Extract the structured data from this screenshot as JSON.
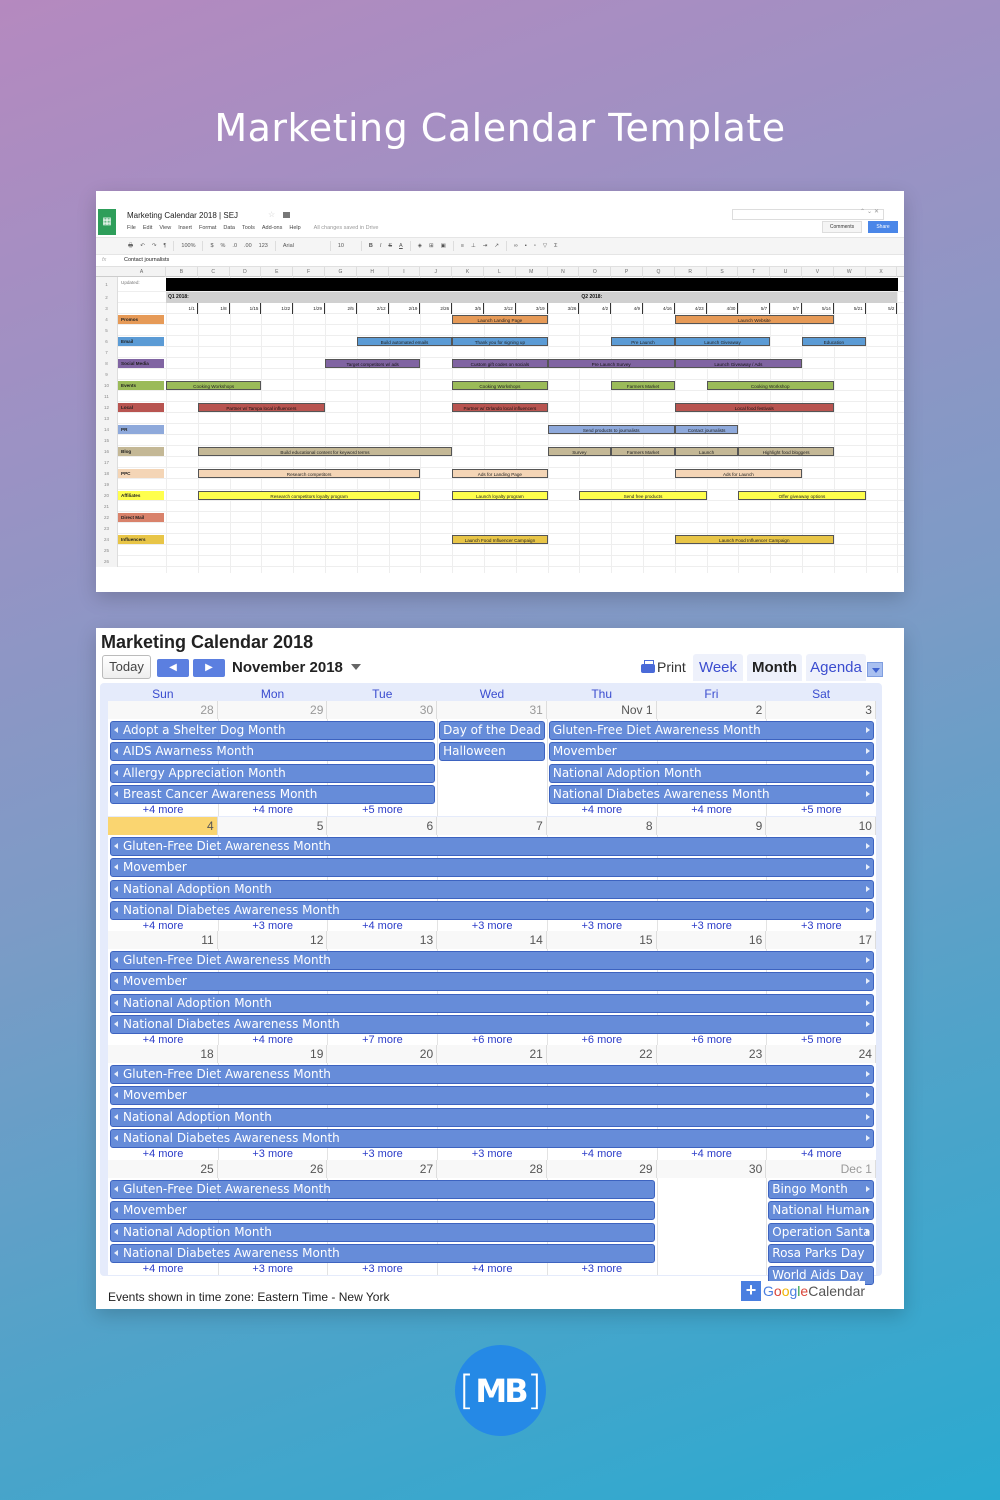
{
  "page": {
    "title": "Marketing Calendar Template",
    "logo_text": "MB",
    "background": {
      "top_left": "#b589bf",
      "bottom_right": "#2aaad0"
    },
    "logo_color": "#2589e6"
  },
  "spreadsheet": {
    "doc_title": "Marketing Calendar 2018 | SEJ",
    "menu": [
      "File",
      "Edit",
      "View",
      "Insert",
      "Format",
      "Data",
      "Tools",
      "Add-ons",
      "Help"
    ],
    "save_status": "All changes saved in Drive",
    "comments_label": "Comments",
    "share_label": "Share",
    "toolbar": {
      "zoom": "100%",
      "currency": "$",
      "percent": "%",
      "decimal_less": ".0",
      "decimal_more": ".00",
      "format": "123",
      "font": "Arial",
      "font_size": "10",
      "bold": "B",
      "italic": "I",
      "strike": "S",
      "text_color": "A"
    },
    "formula_bar_value": "Contact journalists",
    "columns": [
      "A",
      "B",
      "C",
      "D",
      "E",
      "F",
      "G",
      "H",
      "I",
      "J",
      "K",
      "L",
      "M",
      "N",
      "O",
      "P",
      "Q",
      "R",
      "S",
      "T",
      "U",
      "V",
      "W",
      "X"
    ],
    "updated_label": "Updated:",
    "q1_label": "Q1 2018:",
    "q2_label": "Q2 2018:",
    "week_dates": [
      "1/1",
      "1/8",
      "1/15",
      "1/22",
      "1/29",
      "2/5",
      "2/12",
      "2/19",
      "2/26",
      "3/5",
      "3/12",
      "3/19",
      "3/26",
      "4/2",
      "4/9",
      "4/16",
      "4/23",
      "4/30",
      "5/7",
      "5/7",
      "5/14",
      "5/21",
      "5/2"
    ],
    "channels": [
      {
        "row": 4,
        "label": "Promos",
        "color": "#e69a57"
      },
      {
        "row": 6,
        "label": "Email",
        "color": "#5b9bd5"
      },
      {
        "row": 8,
        "label": "Social Media",
        "color": "#8064a2"
      },
      {
        "row": 10,
        "label": "Events",
        "color": "#9bbb59"
      },
      {
        "row": 12,
        "label": "Local",
        "color": "#b85450"
      },
      {
        "row": 14,
        "label": "PR",
        "color": "#8ea9db"
      },
      {
        "row": 16,
        "label": "Blog",
        "color": "#c4b896"
      },
      {
        "row": 18,
        "label": "PPC",
        "color": "#f4d5b6"
      },
      {
        "row": 20,
        "label": "Affiliates",
        "color": "#ffff4d"
      },
      {
        "row": 22,
        "label": "Direct Mail",
        "color": "#d9826b"
      },
      {
        "row": 24,
        "label": "Influencers",
        "color": "#e8c547"
      }
    ],
    "tasks": [
      {
        "row": 4,
        "start": 10,
        "span": 3,
        "label": "Launch Landing Page",
        "color": "#e69a57"
      },
      {
        "row": 4,
        "start": 17,
        "span": 5,
        "label": "Launch Website",
        "color": "#e69a57"
      },
      {
        "row": 6,
        "start": 7,
        "span": 3,
        "label": "Build automated emails",
        "color": "#5b9bd5"
      },
      {
        "row": 6,
        "start": 10,
        "span": 3,
        "label": "Thank you for signing up",
        "color": "#5b9bd5"
      },
      {
        "row": 6,
        "start": 15,
        "span": 2,
        "label": "Pre Launch",
        "color": "#5b9bd5"
      },
      {
        "row": 6,
        "start": 17,
        "span": 3,
        "label": "Launch Giveaway",
        "color": "#5b9bd5"
      },
      {
        "row": 6,
        "start": 21,
        "span": 2,
        "label": "Education",
        "color": "#5b9bd5"
      },
      {
        "row": 8,
        "start": 6,
        "span": 3,
        "label": "Target competitors w/ ads",
        "color": "#8064a2"
      },
      {
        "row": 8,
        "start": 10,
        "span": 3,
        "label": "Custom gift codes on socials",
        "color": "#8064a2"
      },
      {
        "row": 8,
        "start": 13,
        "span": 4,
        "label": "Pre Launch Survey",
        "color": "#8064a2"
      },
      {
        "row": 8,
        "start": 17,
        "span": 4,
        "label": "Launch Giveaway / Ads",
        "color": "#8064a2"
      },
      {
        "row": 10,
        "start": 1,
        "span": 3,
        "label": "Cooking Workshops",
        "color": "#9bbb59"
      },
      {
        "row": 10,
        "start": 10,
        "span": 3,
        "label": "Cooking Workshops",
        "color": "#9bbb59"
      },
      {
        "row": 10,
        "start": 15,
        "span": 2,
        "label": "Farmers Market",
        "color": "#9bbb59"
      },
      {
        "row": 10,
        "start": 18,
        "span": 4,
        "label": "Cooking Workshop",
        "color": "#9bbb59"
      },
      {
        "row": 12,
        "start": 2,
        "span": 4,
        "label": "Partner w/ Tampa local influencers",
        "color": "#b85450"
      },
      {
        "row": 12,
        "start": 10,
        "span": 3,
        "label": "Partner w/ Orlando local influencers",
        "color": "#b85450"
      },
      {
        "row": 12,
        "start": 17,
        "span": 5,
        "label": "Local food festivals",
        "color": "#b85450"
      },
      {
        "row": 14,
        "start": 13,
        "span": 4,
        "label": "Send products to journalists",
        "color": "#8ea9db"
      },
      {
        "row": 14,
        "start": 17,
        "span": 2,
        "label": "Contact journalists",
        "color": "#8ea9db"
      },
      {
        "row": 16,
        "start": 2,
        "span": 8,
        "label": "Build educational content for keyword terms",
        "color": "#c4b896"
      },
      {
        "row": 16,
        "start": 13,
        "span": 2,
        "label": "Survey",
        "color": "#c4b896"
      },
      {
        "row": 16,
        "start": 15,
        "span": 2,
        "label": "Farmers Market",
        "color": "#c4b896"
      },
      {
        "row": 16,
        "start": 17,
        "span": 2,
        "label": "Launch",
        "color": "#c4b896"
      },
      {
        "row": 16,
        "start": 19,
        "span": 3,
        "label": "Highlight food bloggers",
        "color": "#c4b896"
      },
      {
        "row": 18,
        "start": 2,
        "span": 7,
        "label": "Research competitors",
        "color": "#f4d5b6"
      },
      {
        "row": 18,
        "start": 10,
        "span": 3,
        "label": "Ads for Landing Page",
        "color": "#f4d5b6"
      },
      {
        "row": 18,
        "start": 17,
        "span": 4,
        "label": "Ads for Launch",
        "color": "#f4d5b6"
      },
      {
        "row": 20,
        "start": 2,
        "span": 7,
        "label": "Research competitors loyalty program",
        "color": "#ffff4d"
      },
      {
        "row": 20,
        "start": 10,
        "span": 3,
        "label": "Launch loyalty program",
        "color": "#ffff4d"
      },
      {
        "row": 20,
        "start": 14,
        "span": 4,
        "label": "Send free products",
        "color": "#ffff4d"
      },
      {
        "row": 20,
        "start": 19,
        "span": 4,
        "label": "Offer giveaway options",
        "color": "#ffff4d"
      },
      {
        "row": 24,
        "start": 10,
        "span": 3,
        "label": "Launch Food Influencer Campaign",
        "color": "#e8c547"
      },
      {
        "row": 24,
        "start": 17,
        "span": 5,
        "label": "Launch Food Influencer Campaign",
        "color": "#e8c547"
      }
    ]
  },
  "calendar": {
    "title": "Marketing Calendar 2018",
    "today_label": "Today",
    "prev_label": "◀",
    "next_label": "▶",
    "month_label": "November 2018",
    "print_label": "Print",
    "views": [
      {
        "label": "Week",
        "active": false
      },
      {
        "label": "Month",
        "active": true
      },
      {
        "label": "Agenda",
        "active": false
      }
    ],
    "days_of_week": [
      "Sun",
      "Mon",
      "Tue",
      "Wed",
      "Thu",
      "Fri",
      "Sat"
    ],
    "event_color": "#668cd9",
    "today_color": "#fad570",
    "weeks": [
      {
        "days": [
          {
            "label": "28",
            "other": true
          },
          {
            "label": "29",
            "other": true
          },
          {
            "label": "30",
            "other": true
          },
          {
            "label": "31",
            "other": true
          },
          {
            "label": "Nov 1"
          },
          {
            "label": "2"
          },
          {
            "label": "3"
          }
        ],
        "events": [
          {
            "title": "Adopt a Shelter Dog Month",
            "start": 0,
            "span": 3,
            "slot": 0,
            "cont_left": true,
            "cont_right": false
          },
          {
            "title": "AIDS Awarness Month",
            "start": 0,
            "span": 3,
            "slot": 1,
            "cont_left": true,
            "cont_right": false
          },
          {
            "title": "Allergy Appreciation Month",
            "start": 0,
            "span": 3,
            "slot": 2,
            "cont_left": true,
            "cont_right": false
          },
          {
            "title": "Breast Cancer Awareness Month",
            "start": 0,
            "span": 3,
            "slot": 3,
            "cont_left": true,
            "cont_right": false
          },
          {
            "title": "Day of the Dead",
            "start": 3,
            "span": 1,
            "slot": 0,
            "cont_left": false,
            "cont_right": false
          },
          {
            "title": "Halloween",
            "start": 3,
            "span": 1,
            "slot": 1,
            "cont_left": false,
            "cont_right": false
          },
          {
            "title": "Gluten-Free Diet Awareness Month",
            "start": 4,
            "span": 3,
            "slot": 0,
            "cont_left": false,
            "cont_right": true
          },
          {
            "title": "Movember",
            "start": 4,
            "span": 3,
            "slot": 1,
            "cont_left": false,
            "cont_right": true
          },
          {
            "title": "National Adoption Month",
            "start": 4,
            "span": 3,
            "slot": 2,
            "cont_left": false,
            "cont_right": true
          },
          {
            "title": "National Diabetes Awareness Month",
            "start": 4,
            "span": 3,
            "slot": 3,
            "cont_left": false,
            "cont_right": true
          }
        ],
        "more": [
          "+4 more",
          "+4 more",
          "+5 more",
          "",
          "+4 more",
          "+4 more",
          "+5 more"
        ]
      },
      {
        "days": [
          {
            "label": "4",
            "today": true
          },
          {
            "label": "5"
          },
          {
            "label": "6"
          },
          {
            "label": "7"
          },
          {
            "label": "8"
          },
          {
            "label": "9"
          },
          {
            "label": "10"
          }
        ],
        "events": [
          {
            "title": "Gluten-Free Diet Awareness Month",
            "start": 0,
            "span": 7,
            "slot": 0,
            "cont_left": true,
            "cont_right": true
          },
          {
            "title": "Movember",
            "start": 0,
            "span": 7,
            "slot": 1,
            "cont_left": true,
            "cont_right": true
          },
          {
            "title": "National Adoption Month",
            "start": 0,
            "span": 7,
            "slot": 2,
            "cont_left": true,
            "cont_right": true
          },
          {
            "title": "National Diabetes Awareness Month",
            "start": 0,
            "span": 7,
            "slot": 3,
            "cont_left": true,
            "cont_right": true
          }
        ],
        "more": [
          "+4 more",
          "+3 more",
          "+4 more",
          "+3 more",
          "+3 more",
          "+3 more",
          "+3 more"
        ]
      },
      {
        "days": [
          {
            "label": "11"
          },
          {
            "label": "12"
          },
          {
            "label": "13"
          },
          {
            "label": "14"
          },
          {
            "label": "15"
          },
          {
            "label": "16"
          },
          {
            "label": "17"
          }
        ],
        "events": [
          {
            "title": "Gluten-Free Diet Awareness Month",
            "start": 0,
            "span": 7,
            "slot": 0,
            "cont_left": true,
            "cont_right": true
          },
          {
            "title": "Movember",
            "start": 0,
            "span": 7,
            "slot": 1,
            "cont_left": true,
            "cont_right": true
          },
          {
            "title": "National Adoption Month",
            "start": 0,
            "span": 7,
            "slot": 2,
            "cont_left": true,
            "cont_right": true
          },
          {
            "title": "National Diabetes Awareness Month",
            "start": 0,
            "span": 7,
            "slot": 3,
            "cont_left": true,
            "cont_right": true
          }
        ],
        "more": [
          "+4 more",
          "+4 more",
          "+7 more",
          "+6 more",
          "+6 more",
          "+6 more",
          "+5 more"
        ]
      },
      {
        "days": [
          {
            "label": "18"
          },
          {
            "label": "19"
          },
          {
            "label": "20"
          },
          {
            "label": "21"
          },
          {
            "label": "22"
          },
          {
            "label": "23"
          },
          {
            "label": "24"
          }
        ],
        "events": [
          {
            "title": "Gluten-Free Diet Awareness Month",
            "start": 0,
            "span": 7,
            "slot": 0,
            "cont_left": true,
            "cont_right": true
          },
          {
            "title": "Movember",
            "start": 0,
            "span": 7,
            "slot": 1,
            "cont_left": true,
            "cont_right": true
          },
          {
            "title": "National Adoption Month",
            "start": 0,
            "span": 7,
            "slot": 2,
            "cont_left": true,
            "cont_right": true
          },
          {
            "title": "National Diabetes Awareness Month",
            "start": 0,
            "span": 7,
            "slot": 3,
            "cont_left": true,
            "cont_right": true
          }
        ],
        "more": [
          "+4 more",
          "+3 more",
          "+3 more",
          "+3 more",
          "+4 more",
          "+4 more",
          "+4 more"
        ]
      },
      {
        "days": [
          {
            "label": "25"
          },
          {
            "label": "26"
          },
          {
            "label": "27"
          },
          {
            "label": "28"
          },
          {
            "label": "29"
          },
          {
            "label": "30"
          },
          {
            "label": "Dec 1",
            "other": true
          }
        ],
        "events": [
          {
            "title": "Gluten-Free Diet Awareness Month",
            "start": 0,
            "span": 5,
            "slot": 0,
            "cont_left": true,
            "cont_right": false
          },
          {
            "title": "Movember",
            "start": 0,
            "span": 5,
            "slot": 1,
            "cont_left": true,
            "cont_right": false
          },
          {
            "title": "National Adoption Month",
            "start": 0,
            "span": 5,
            "slot": 2,
            "cont_left": true,
            "cont_right": false
          },
          {
            "title": "National Diabetes Awareness Month",
            "start": 0,
            "span": 5,
            "slot": 3,
            "cont_left": true,
            "cont_right": false
          },
          {
            "title": "Bingo Month",
            "start": 6,
            "span": 1,
            "slot": 0,
            "cont_left": false,
            "cont_right": true
          },
          {
            "title": "National Human",
            "start": 6,
            "span": 1,
            "slot": 1,
            "cont_left": false,
            "cont_right": true
          },
          {
            "title": "Operation Santa",
            "start": 6,
            "span": 1,
            "slot": 2,
            "cont_left": false,
            "cont_right": true
          },
          {
            "title": "Rosa Parks Day",
            "start": 6,
            "span": 1,
            "slot": 3,
            "cont_left": false,
            "cont_right": false
          },
          {
            "title": "World Aids Day",
            "start": 6,
            "span": 1,
            "slot": 4,
            "cont_left": false,
            "cont_right": false
          }
        ],
        "more": [
          "+4 more",
          "+3 more",
          "+3 more",
          "+4 more",
          "+3 more",
          "",
          ""
        ]
      }
    ],
    "timezone_text": "Events shown in time zone: Eastern Time - New York",
    "badge": {
      "plus": "+",
      "google": [
        "G",
        "o",
        "o",
        "g",
        "l",
        "e"
      ],
      "calendar": "Calendar"
    }
  }
}
